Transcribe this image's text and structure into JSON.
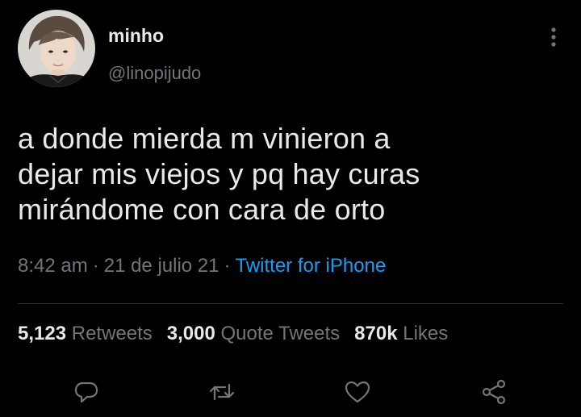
{
  "user": {
    "display_name": "minho",
    "handle": "@linopijudo",
    "avatar_icon": "avatar-photo"
  },
  "tweet": {
    "lines": [
      "a donde mierda m vinieron a",
      "dejar mis viejos y pq hay curas",
      "mirándome con cara de orto"
    ],
    "time": "8:42 am",
    "date": "21 de julio 21",
    "source": "Twitter for iPhone"
  },
  "stats": {
    "retweets_count": "5,123",
    "retweets_label": "Retweets",
    "quote_count": "3,000",
    "quote_label": "Quote Tweets",
    "likes_count": "870k",
    "likes_label": "Likes"
  },
  "actions": {
    "reply_icon": "reply-icon",
    "retweet_icon": "retweet-icon",
    "like_icon": "heart-icon",
    "share_icon": "share-icon"
  },
  "colors": {
    "background": "#000000",
    "primary_text": "#e7e9ea",
    "secondary_text": "#71767b",
    "accent": "#1d9bf0",
    "divider": "#2f3336"
  }
}
